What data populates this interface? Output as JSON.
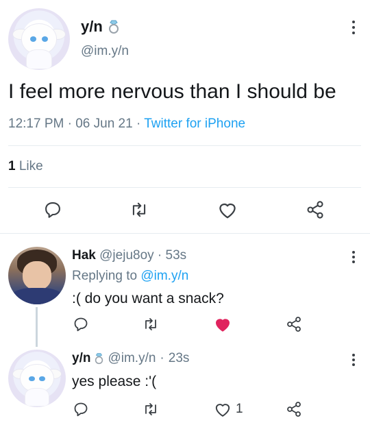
{
  "main_tweet": {
    "display_name": "y/n",
    "badge_icon": "ring-icon",
    "handle": "@im.y/n",
    "text": "I feel more nervous than I should be",
    "time": "12:17 PM",
    "separator": "·",
    "date": "06 Jun 21",
    "source": "Twitter for iPhone",
    "likes_count": "1",
    "likes_label": "Like"
  },
  "reply_1": {
    "display_name": "Hak",
    "handle": "@jeju8oy",
    "separator": "·",
    "time": "53s",
    "replying_prefix": "Replying to",
    "replying_to": "@im.y/n",
    "text": ":( do you want a snack?",
    "liked": true,
    "like_color": "#e0245e"
  },
  "reply_2": {
    "display_name": "y/n",
    "badge_icon": "ring-icon",
    "handle": "@im.y/n",
    "separator": "·",
    "time": "23s",
    "text": "yes please :'(",
    "like_count": "1"
  },
  "colors": {
    "accent": "#1da1f2",
    "text": "#14171a",
    "muted": "#657786",
    "divider": "#e6ecf0"
  }
}
